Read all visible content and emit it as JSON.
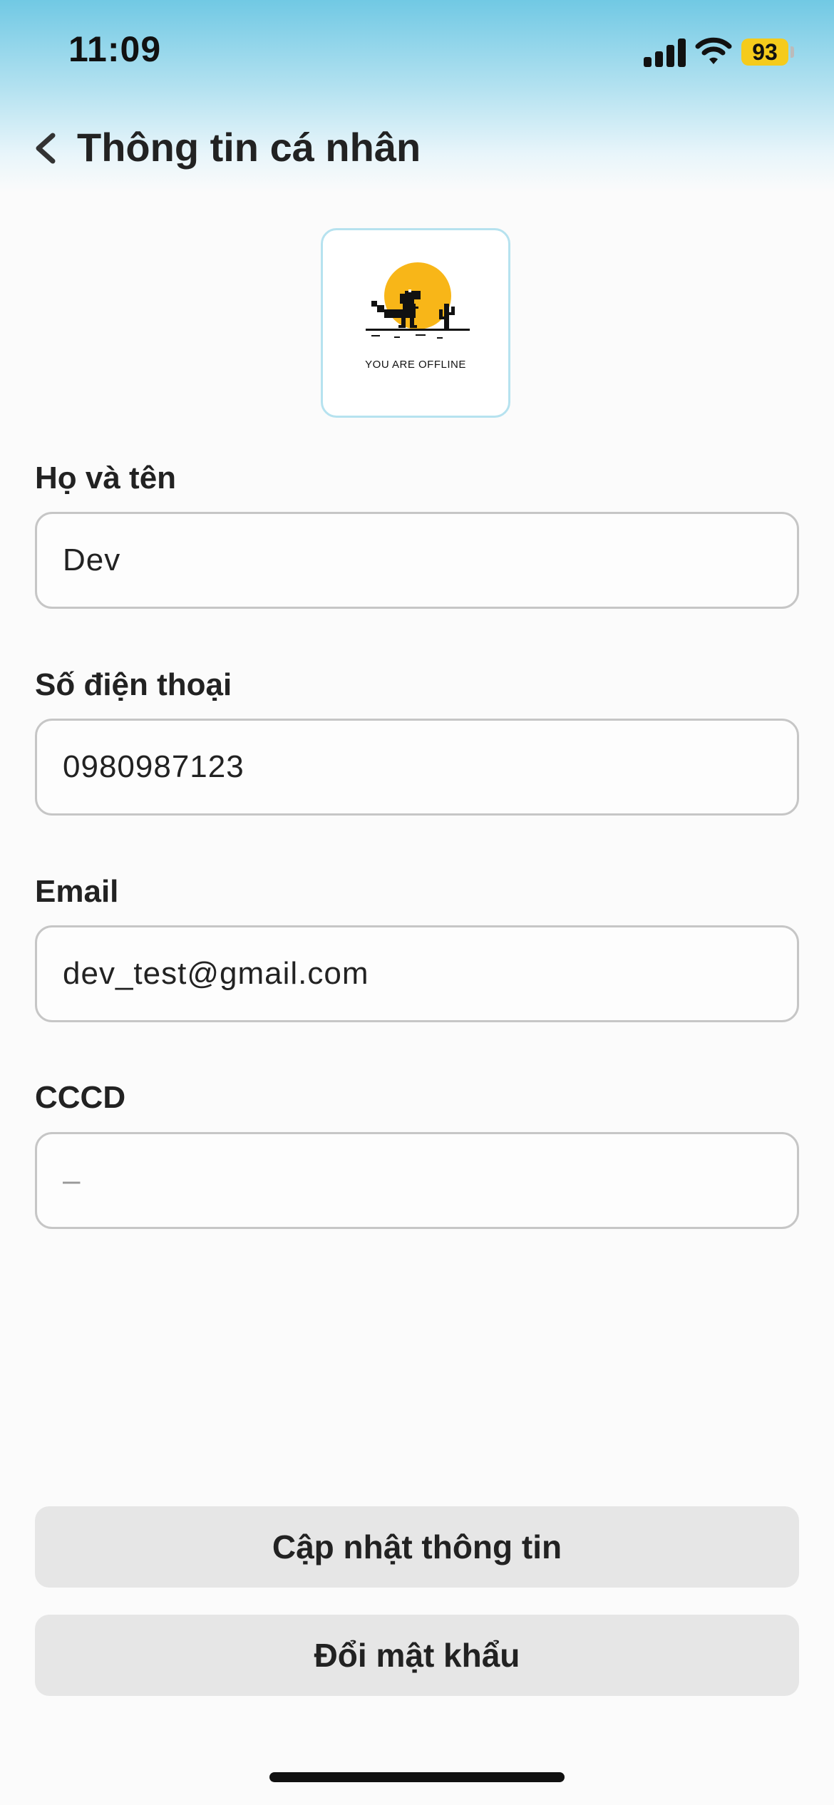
{
  "status_bar": {
    "time": "11:09",
    "battery": "93",
    "icons": [
      "cellular-signal-icon",
      "wifi-icon",
      "battery-icon"
    ]
  },
  "header": {
    "back_icon": "chevron-left-icon",
    "title": "Thông tin cá nhân"
  },
  "avatar": {
    "caption": "YOU ARE OFFLINE",
    "sun_color": "#F8B618"
  },
  "form": {
    "fields": [
      {
        "label": "Họ và tên",
        "value": "Dev"
      },
      {
        "label": "Số điện thoại",
        "value": "0980987123"
      },
      {
        "label": "Email",
        "value": "dev_test@gmail.com"
      },
      {
        "label": "CCCD",
        "value": "–"
      }
    ]
  },
  "actions": {
    "update": "Cập nhật thông tin",
    "change_password": "Đổi mật khẩu"
  },
  "colors": {
    "header_gradient_top": "#71C9E4",
    "battery": "#F5CB1C",
    "button_bg": "#E6E6E6",
    "input_border": "#C6C6C6"
  }
}
